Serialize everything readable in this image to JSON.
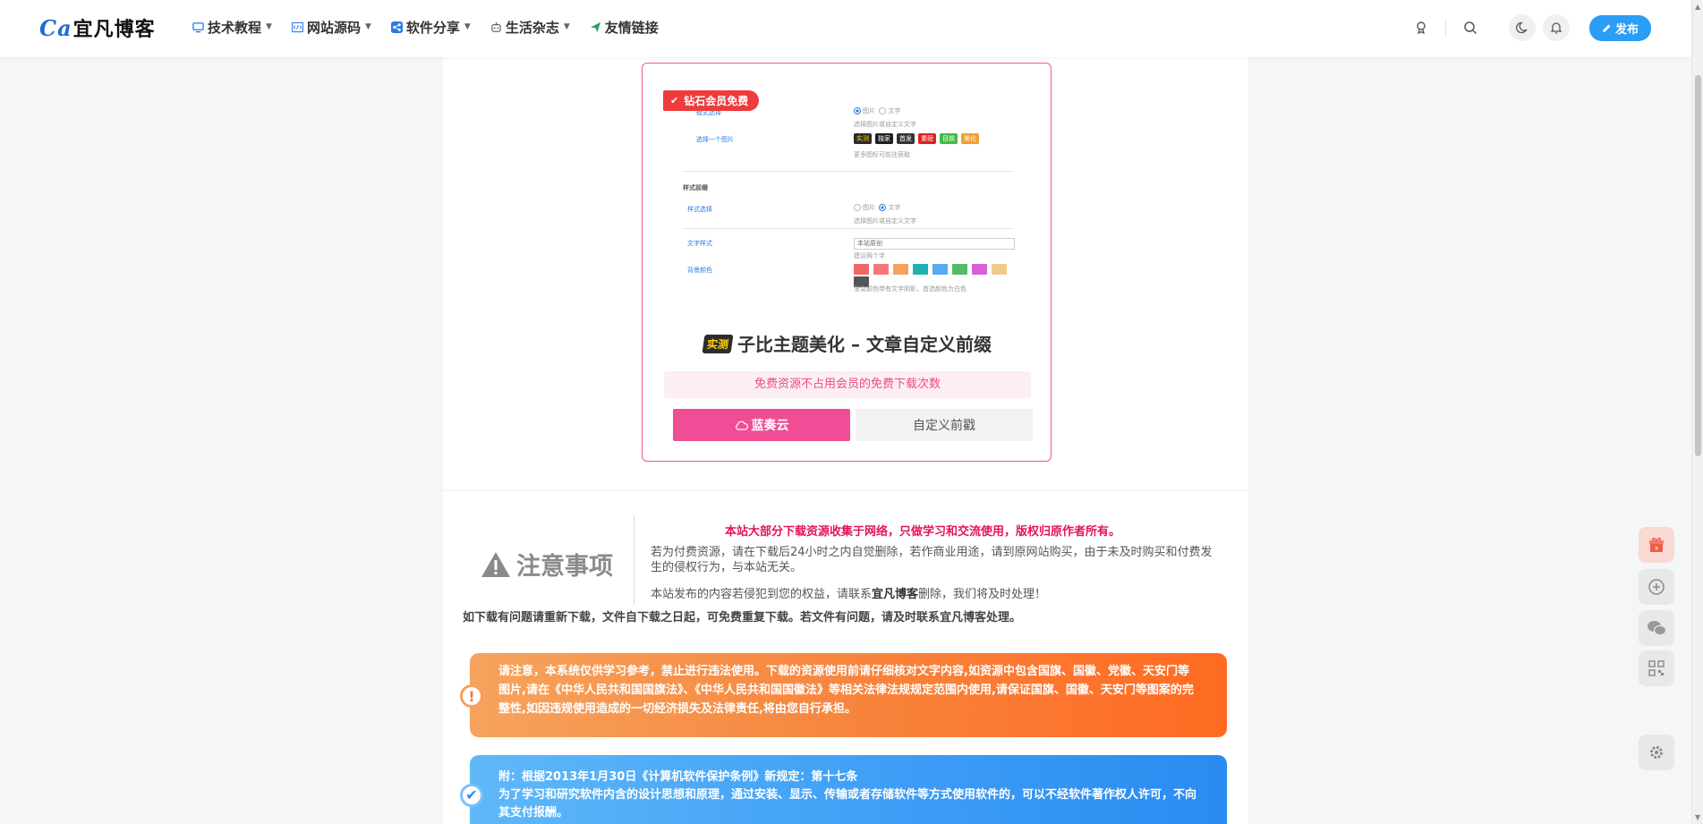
{
  "header": {
    "logo_mark": "Ca",
    "logo_text": "宜凡博客",
    "nav": [
      {
        "label": "技术教程",
        "icon": "monitor-icon",
        "dropdown": true
      },
      {
        "label": "网站源码",
        "icon": "code-icon",
        "dropdown": true
      },
      {
        "label": "软件分享",
        "icon": "share-icon",
        "dropdown": true
      },
      {
        "label": "生活杂志",
        "icon": "robot-icon",
        "dropdown": true
      },
      {
        "label": "友情链接",
        "icon": "send-icon",
        "dropdown": false
      }
    ],
    "publish_label": "发布"
  },
  "card": {
    "badge": "钻石会员免费",
    "preview": {
      "row1_label": "模式选择",
      "row1_opt_a": "图片",
      "row1_opt_b": "文字",
      "row1_hint": "选择图片或自定义文字",
      "row2_label": "选择一个图片",
      "tags": [
        {
          "text": "实测",
          "color": "#2b2b2b"
        },
        {
          "text": "独家",
          "color": "#1f1f1f"
        },
        {
          "text": "首发",
          "color": "#333333"
        },
        {
          "text": "重磅",
          "color": "#e02020"
        },
        {
          "text": "目前",
          "color": "#44bb44"
        },
        {
          "text": "美化",
          "color": "#f0a030"
        }
      ],
      "row2_hint": "更多图标可前往获取",
      "section2": "样式前缀",
      "row3_label": "样式选择",
      "row3_opt_a": "图片",
      "row3_opt_b": "文字",
      "row3_hint": "选择图片或自定义文字",
      "row4_label": "文字样式",
      "row4_value": "本站原创",
      "row4_hint": "建议两个字",
      "row5_label": "背景颜色",
      "swatches": [
        "#f06767",
        "#f47a7a",
        "#f7a15d",
        "#1fb0b0",
        "#5aaaf0",
        "#55bb66",
        "#d85fd8",
        "#f2c98d",
        "#555555"
      ],
      "row5_hint": "渐变颜色带有文字阴影，首选颜色为白色"
    },
    "title_tag": "实测",
    "title": "子比主题美化 – 文章自定义前缀",
    "free_notice": "免费资源不占用会员的免费下载次数",
    "btn_download": "蓝奏云",
    "btn_custom": "自定义前戳"
  },
  "notice": {
    "heading": "注意事项",
    "red_line": "本站大部分下载资源收集于网络，只做学习和交流使用，版权归原作者所有。",
    "p1": "若为付费资源，请在下载后24小时之内自觉删除，若作商业用途，请到原网站购买，由于未及时购买和付费发生的侵权行为，与本站无关。",
    "p2_pre": "本站发布的内容若侵犯到您的权益，请联系",
    "p2_site": "宜凡博客",
    "p2_post": "删除，我们将及时处理！",
    "bold_line": "如下载有问题请重新下载，文件自下载之日起，可免费重复下载。若文件有问题，请及时联系宜凡博客处理。"
  },
  "alerts": {
    "orange": "请注意，本系统仅供学习参考，禁止进行违法使用。下载的资源使用前请仔细核对文字内容,如资源中包含国旗、国徽、党徽、天安门等图片,请在《中华人民共和国国旗法》、《中华人民共和国国徽法》等相关法律法规规定范围内使用,请保证国旗、国徽、天安门等图案的完整性,如因违规使用造成的一切经济损失及法律责任,将由您自行承担。",
    "blue_title": "附：根据2013年1月30日《计算机软件保护条例》新规定：第十七条",
    "blue_body": "为了学习和研究软件内含的设计思想和原理，通过安装、显示、传输或者存储软件等方式使用软件的，可以不经软件著作权人许可，不向其支付报酬。"
  },
  "floating": [
    "gift-icon",
    "add-icon",
    "wechat-icon",
    "qrcode-icon",
    "settings-icon"
  ]
}
